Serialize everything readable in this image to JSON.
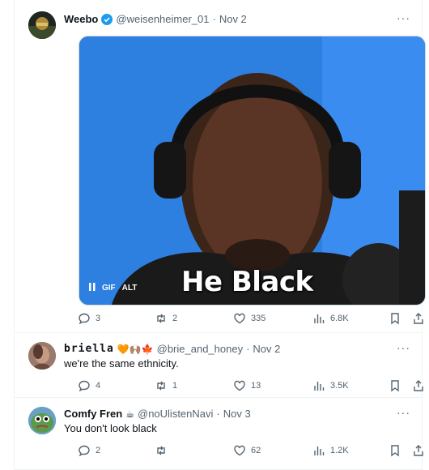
{
  "tweets": [
    {
      "name": "Weebo",
      "handle": "@weisenheimer_01",
      "separator": "·",
      "date": "Nov 2",
      "verified": true,
      "media": {
        "caption": "He Black",
        "gif_label": "GIF",
        "alt_label": "ALT"
      },
      "actions": {
        "replies": "3",
        "retweets": "2",
        "likes": "335",
        "views": "6.8K"
      }
    },
    {
      "name": "briella",
      "name_emoji": "🧡🙌🏽🍁",
      "handle": "@brie_and_honey",
      "separator": "·",
      "date": "Nov 2",
      "text": "we're the same ethnicity.",
      "actions": {
        "replies": "4",
        "retweets": "1",
        "likes": "13",
        "views": "3.5K"
      }
    },
    {
      "name": "Comfy Fren",
      "name_emoji": "☕",
      "handle": "@noUlistenNavi",
      "separator": "·",
      "date": "Nov 3",
      "text": "You don't look black",
      "actions": {
        "replies": "2",
        "retweets": "",
        "likes": "62",
        "views": "1.2K"
      }
    }
  ],
  "icons": {
    "more": "more-icon",
    "reply": "reply-icon",
    "retweet": "retweet-icon",
    "like": "heart-icon",
    "views": "views-icon",
    "bookmark": "bookmark-icon",
    "share": "share-icon",
    "pause": "pause-icon"
  },
  "colors": {
    "accent": "#1d9bf0",
    "muted": "#536471",
    "gif_bg": "#2d7fe0"
  }
}
